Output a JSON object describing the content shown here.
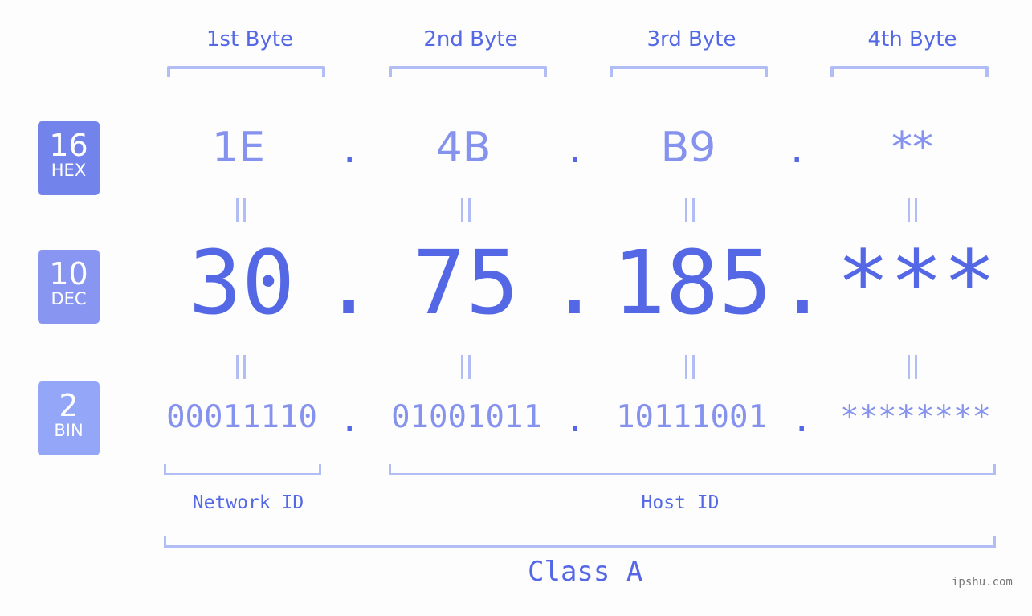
{
  "bytes": [
    {
      "label": "1st Byte",
      "hex": "1E",
      "dec": "30",
      "bin": "00011110"
    },
    {
      "label": "2nd Byte",
      "hex": "4B",
      "dec": "75",
      "bin": "01001011"
    },
    {
      "label": "3rd Byte",
      "hex": "B9",
      "dec": "185",
      "bin": "10111001"
    },
    {
      "label": "4th Byte",
      "hex": "**",
      "dec": "***",
      "bin": "********"
    }
  ],
  "separator": ".",
  "badges": {
    "hex": {
      "num": "16",
      "label": "HEX",
      "color": "#7383ec"
    },
    "dec": {
      "num": "10",
      "label": "DEC",
      "color": "#8896f2"
    },
    "bin": {
      "num": "2",
      "label": "BIN",
      "color": "#93a6f8"
    }
  },
  "sections": {
    "network": "Network ID",
    "host": "Host ID",
    "class": "Class A"
  },
  "footer": "ipshu.com",
  "colors": {
    "primary": "#5468e6",
    "secondary": "#8592ee",
    "bracket": "#b2bcf5",
    "background": "#fcfdfc"
  }
}
